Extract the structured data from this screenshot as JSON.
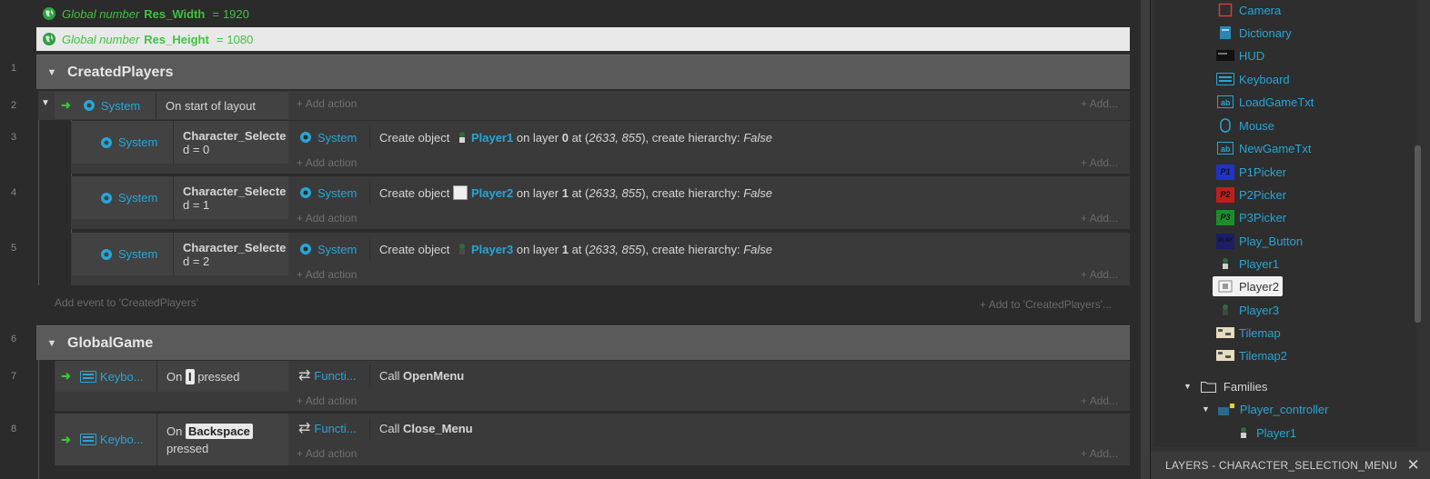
{
  "sheet": {
    "line_numbers": [
      "1",
      "2",
      "3",
      "4",
      "5",
      "6",
      "7",
      "8"
    ],
    "globals": [
      {
        "prefix": "Global number",
        "name": "Res_Width",
        "equals": "=",
        "value": "1920"
      },
      {
        "prefix": "Global number",
        "name": "Res_Height",
        "equals": "=",
        "value": "1080"
      }
    ],
    "groups": [
      {
        "title": "CreatedPlayers"
      },
      {
        "title": "GlobalGame"
      }
    ],
    "event2": {
      "object": "System",
      "condition": "On start of layout",
      "add_action": "Add action",
      "add_right": "Add..."
    },
    "subevents": [
      {
        "object": "System",
        "cond_name": "Character_Selecte",
        "cond_rest": "d = 0",
        "act_object": "System",
        "act_prefix": "Create object",
        "player": "Player1",
        "on_layer": "on layer",
        "layer": "0",
        "at": "at (",
        "coords": "2633, 855",
        "tail": "), create hierarchy:",
        "hier": "False",
        "add_action": "Add action",
        "add_right": "Add..."
      },
      {
        "object": "System",
        "cond_name": "Character_Selecte",
        "cond_rest": "d = 1",
        "act_object": "System",
        "act_prefix": "Create object",
        "player": "Player2",
        "on_layer": "on layer",
        "layer": "1",
        "at": "at (",
        "coords": "2633, 855",
        "tail": "), create hierarchy:",
        "hier": "False",
        "add_action": "Add action",
        "add_right": "Add..."
      },
      {
        "object": "System",
        "cond_name": "Character_Selecte",
        "cond_rest": "d = 2",
        "act_object": "System",
        "act_prefix": "Create object",
        "player": "Player3",
        "on_layer": "on layer",
        "layer": "1",
        "at": "at (",
        "coords": "2633, 855",
        "tail": "), create hierarchy:",
        "hier": "False",
        "add_action": "Add action",
        "add_right": "Add..."
      }
    ],
    "add_event": "Add event to 'CreatedPlayers'",
    "add_to_group": "Add to 'CreatedPlayers'...",
    "event7": {
      "object": "Keybo...",
      "on": "On",
      "key": "I",
      "pressed": "pressed",
      "act_object": "Functi...",
      "call": "Call",
      "func": "OpenMenu",
      "add_action": "Add action",
      "add_right": "Add..."
    },
    "event8": {
      "object": "Keybo...",
      "on": "On",
      "key": "Backspace",
      "pressed": "pressed",
      "act_object": "Functi...",
      "call": "Call",
      "func": "Close_Menu",
      "add_action": "Add action",
      "add_right": "Add..."
    }
  },
  "project_tree": {
    "items": [
      {
        "label": "Camera",
        "icon": "camera-icon"
      },
      {
        "label": "Dictionary",
        "icon": "dictionary-icon"
      },
      {
        "label": "HUD",
        "icon": "hud-icon"
      },
      {
        "label": "Keyboard",
        "icon": "keyboard-icon"
      },
      {
        "label": "LoadGameTxt",
        "icon": "text-icon"
      },
      {
        "label": "Mouse",
        "icon": "mouse-icon"
      },
      {
        "label": "NewGameTxt",
        "icon": "text-icon"
      },
      {
        "label": "P1Picker",
        "icon": "p1-sprite-icon",
        "thumb": "P1"
      },
      {
        "label": "P2Picker",
        "icon": "p2-sprite-icon",
        "thumb": "P2"
      },
      {
        "label": "P3Picker",
        "icon": "p3-sprite-icon",
        "thumb": "P3"
      },
      {
        "label": "Play_Button",
        "icon": "play-button-sprite-icon",
        "thumb": "PLAY"
      },
      {
        "label": "Player1",
        "icon": "player1-sprite-icon"
      },
      {
        "label": "Player2",
        "icon": "player2-sprite-icon"
      },
      {
        "label": "Player3",
        "icon": "player3-sprite-icon"
      },
      {
        "label": "Tilemap",
        "icon": "tilemap-icon"
      },
      {
        "label": "Tilemap2",
        "icon": "tilemap-icon"
      }
    ],
    "families_label": "Families",
    "family": "Player_controller",
    "family_member": "Player1"
  },
  "layers_bar": {
    "title": "LAYERS - CHARACTER_SELECTION_MENU",
    "close": "✕"
  },
  "colors": {
    "accent": "#27a5d6",
    "global_var": "#3fc23f",
    "group_bg": "#5a5a5a"
  }
}
